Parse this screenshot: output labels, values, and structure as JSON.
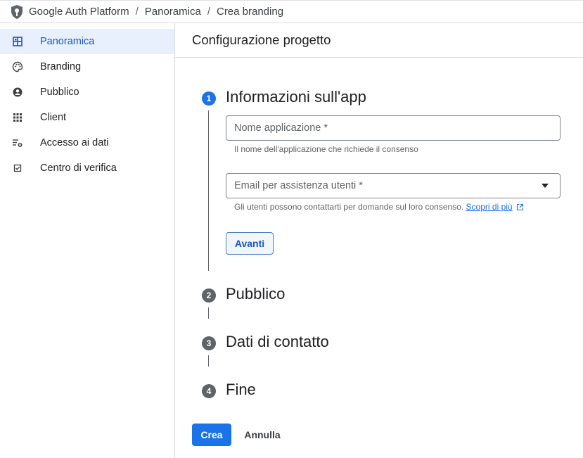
{
  "breadcrumb": {
    "items": [
      "Google Auth Platform",
      "Panoramica",
      "Crea branding"
    ],
    "separator": "/"
  },
  "sidebar": {
    "items": [
      {
        "label": "Panoramica",
        "icon": "dashboard-icon",
        "active": true
      },
      {
        "label": "Branding",
        "icon": "palette-icon",
        "active": false
      },
      {
        "label": "Pubblico",
        "icon": "account-circle-icon",
        "active": false
      },
      {
        "label": "Client",
        "icon": "grid-icon",
        "active": false
      },
      {
        "label": "Accesso ai dati",
        "icon": "data-settings-icon",
        "active": false
      },
      {
        "label": "Centro di verifica",
        "icon": "checkbox-icon",
        "active": false
      }
    ]
  },
  "main": {
    "title": "Configurazione progetto",
    "steps": [
      {
        "number": "1",
        "title": "Informazioni sull'app",
        "active": true
      },
      {
        "number": "2",
        "title": "Pubblico",
        "active": false
      },
      {
        "number": "3",
        "title": "Dati di contatto",
        "active": false
      },
      {
        "number": "4",
        "title": "Fine",
        "active": false
      }
    ],
    "form": {
      "app_name": {
        "placeholder": "Nome applicazione *",
        "helper": "Il nome dell'applicazione che richiede il consenso"
      },
      "support_email": {
        "placeholder": "Email per assistenza utenti *",
        "helper": "Gli utenti possono contattarti per domande sul loro consenso.",
        "link": "Scopri di più"
      },
      "next_label": "Avanti"
    },
    "actions": {
      "create_label": "Crea",
      "cancel_label": "Annulla"
    }
  },
  "colors": {
    "accent": "#1a73e8",
    "active_nav_bg": "#e8f0fe",
    "inactive_step": "#5f6368"
  }
}
